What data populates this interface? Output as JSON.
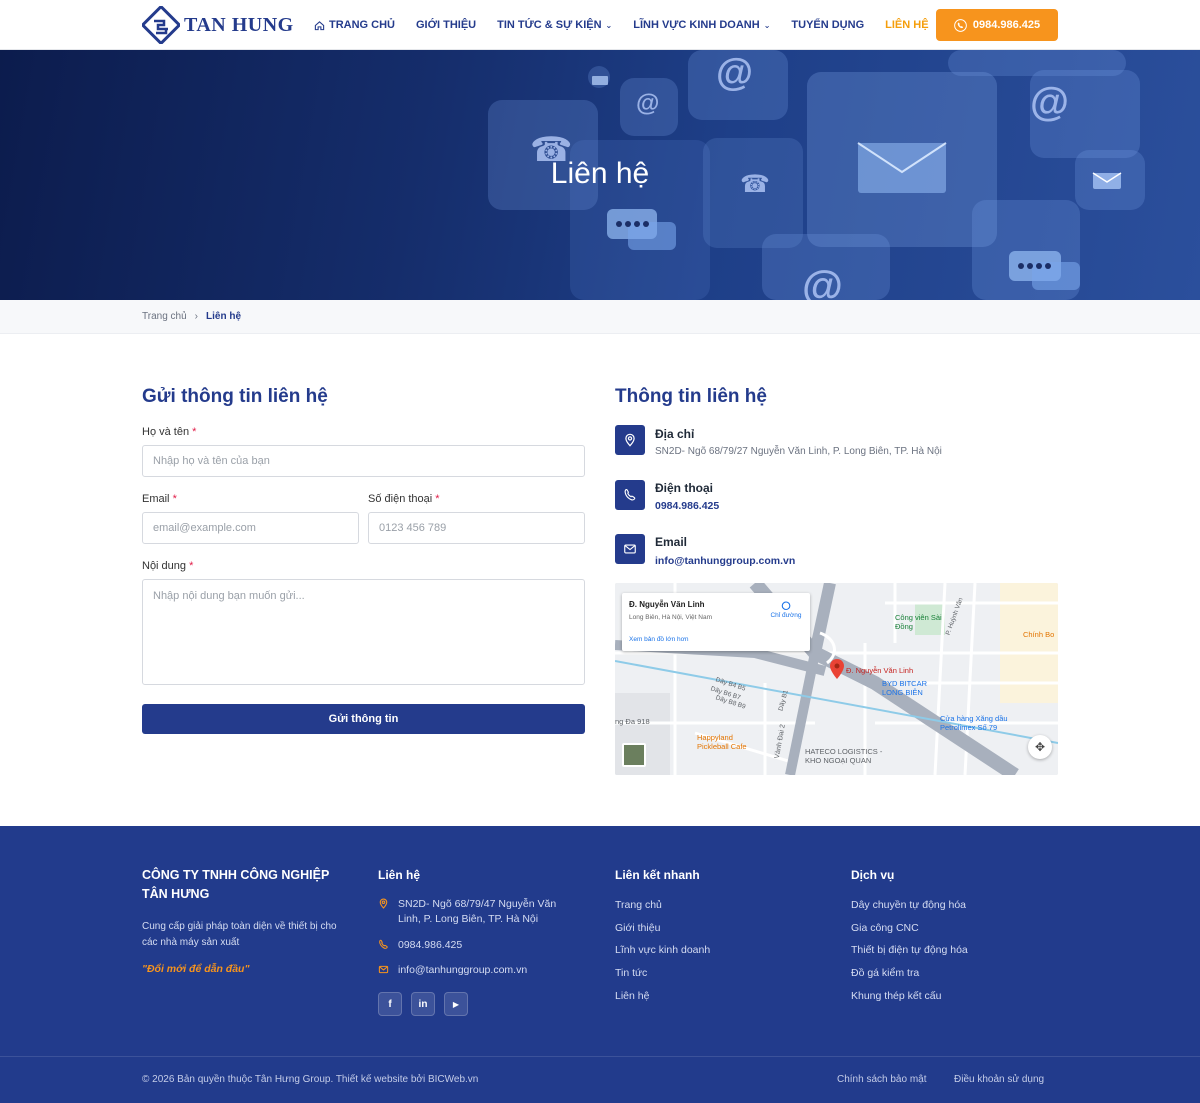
{
  "header": {
    "logo_text": "TAN HUNG",
    "nav": [
      {
        "label": "TRANG CHỦ"
      },
      {
        "label": "GIỚI THIỆU"
      },
      {
        "label": "TIN TỨC & SỰ KIỆN"
      },
      {
        "label": "LĨNH VỰC KINH DOANH"
      },
      {
        "label": "TUYỂN DỤNG"
      },
      {
        "label": "LIÊN HỆ"
      }
    ],
    "phone": "0984.986.425"
  },
  "hero": {
    "title": "Liên hệ"
  },
  "breadcrumb": {
    "home": "Trang chủ",
    "current": "Liên hệ"
  },
  "form": {
    "title": "Gửi thông tin liên hệ",
    "name_label": "Họ và tên",
    "name_placeholder": "Nhập họ và tên của bạn",
    "email_label": "Email",
    "email_placeholder": "email@example.com",
    "phone_label": "Số điện thoại",
    "phone_placeholder": "0123 456 789",
    "content_label": "Nội dung",
    "content_placeholder": "Nhập nội dung bạn muốn gửi...",
    "required_mark": "*",
    "submit": "Gửi thông tin"
  },
  "info": {
    "title": "Thông tin liên hệ",
    "address_title": "Địa chỉ",
    "address": "SN2D- Ngõ 68/79/27 Nguyễn Văn Linh, P. Long Biên, TP. Hà Nội",
    "phone_title": "Điện thoại",
    "phone": "0984.986.425",
    "email_title": "Email",
    "email": "info@tanhunggroup.com.vn"
  },
  "map": {
    "place_name": "Đ. Nguyễn Văn Linh",
    "place_sub": "Long Biên, Hà Nội, Việt Nam",
    "directions": "Chỉ đường",
    "larger_map": "Xem bản đồ lớn hơn",
    "pin_label": "Đ. Nguyễn Văn Linh",
    "labels": [
      "Công viên Sài Đồng",
      "BYD BITCAR LONG BIÊN",
      "Cửa hàng Xăng dầu Petrolimex Số 79",
      "HATECO LOGISTICS - KHO NGOẠI QUAN",
      "Happyland Pickleball Cafe",
      "Chính Bo",
      "Dãy B4 B5",
      "Dãy B6 B7",
      "Dãy B8 B9",
      "Dãy B1",
      "Vành Đai 2",
      "ng Đa 918",
      "P. Huỳnh Văn"
    ]
  },
  "footer": {
    "company": "CÔNG TY TNHH CÔNG NGHIỆP TÂN HƯNG",
    "description": "Cung cấp giải pháp toàn diện về thiết bị cho các nhà máy sản xuất",
    "slogan": "\"Đổi mới để dẫn đầu\"",
    "contact_title": "Liên hệ",
    "address": "SN2D- Ngõ 68/79/47 Nguyễn Văn Linh, P. Long Biên, TP. Hà Nội",
    "phone": "0984.986.425",
    "email": "info@tanhunggroup.com.vn",
    "quick_title": "Liên kết nhanh",
    "quick_links": [
      "Trang chủ",
      "Giới thiệu",
      "Lĩnh vực kinh doanh",
      "Tin tức",
      "Liên hệ"
    ],
    "services_title": "Dịch vụ",
    "services": [
      "Dây chuyền tự động hóa",
      "Gia công CNC",
      "Thiết bị điện tự động hóa",
      "Đồ gá kiểm tra",
      "Khung thép kết cấu"
    ],
    "social": [
      "f",
      "in",
      "▶"
    ],
    "copyright": "© 2026 Bản quyền thuộc Tân Hưng Group. Thiết kế website bởi BICWeb.vn",
    "privacy": "Chính sách bảo mật",
    "terms": "Điều khoản sử dụng"
  },
  "colors": {
    "primary": "#243b8c",
    "accent": "#f7941d",
    "footer_bg": "#223b8c"
  }
}
